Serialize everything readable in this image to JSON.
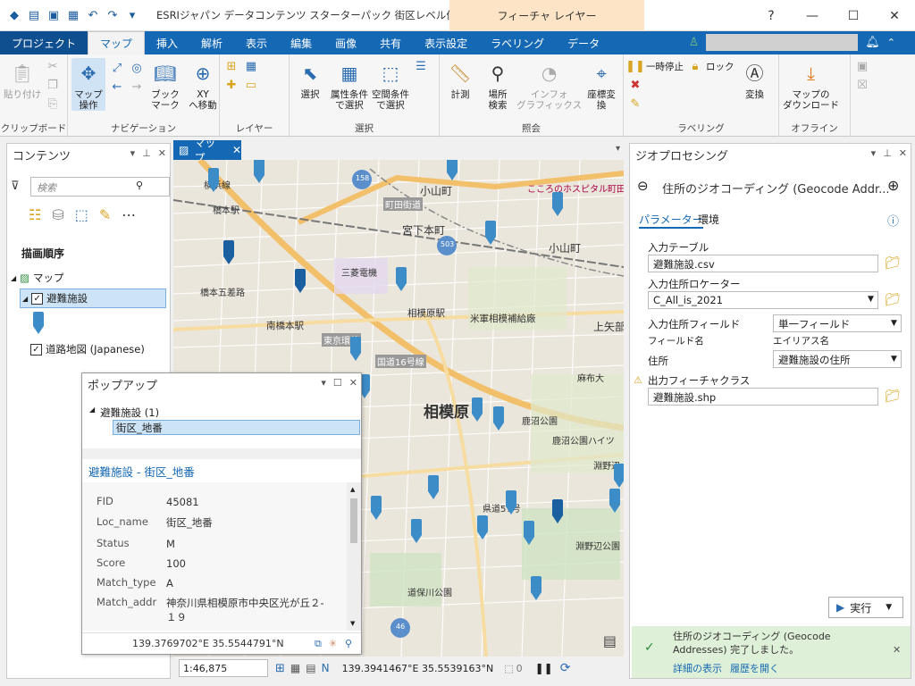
{
  "window": {
    "title": "ESRIジャパン データコンテンツ スターターパック 街区レベル住所 - マッ...",
    "context_tab": "フィーチャ レイヤー",
    "help": "?",
    "minimize": "—",
    "maximize": "☐",
    "close": "✕"
  },
  "tabs": [
    "マップ",
    "挿入",
    "解析",
    "表示",
    "編集",
    "画像",
    "共有",
    "表示設定",
    "ラベリング",
    "データ"
  ],
  "project_tab": "プロジェクト",
  "ribbon": {
    "clipboard": {
      "paste": "貼り付け",
      "label": "クリップボード"
    },
    "navigation": {
      "explore": "マップ\n操作",
      "bookmarks": "ブック\nマーク",
      "go_xy": "XY\nへ移動",
      "label": "ナビゲーション"
    },
    "layer": {
      "label": "レイヤー"
    },
    "selection": {
      "select": "選択",
      "by_attr": "属性条件\nで選択",
      "by_loc": "空間条件\nで選択",
      "label": "選択"
    },
    "inquiry": {
      "measure": "計測",
      "locate": "場所\n検索",
      "infographics": "インフォ\nグラフィックス",
      "convert_coords": "座標変換",
      "label": "照会"
    },
    "labeling": {
      "pause": "一時停止",
      "lock": "ロック",
      "convert": "変換",
      "label": "ラベリング"
    },
    "offline": {
      "download": "マップの\nダウンロード",
      "label": "オフライン"
    }
  },
  "contents": {
    "title": "コンテンツ",
    "search_placeholder": "検索",
    "draw_order": "描画順序",
    "map": "マップ",
    "layer1": "避難施設",
    "layer2": "道路地図 (Japanese)"
  },
  "map": {
    "tab": "マップ",
    "labels": [
      "小山町",
      "宮下本町",
      "小山町",
      "三菱電機",
      "橋本五差路",
      "相模原駅",
      "南橋本駅",
      "米軍相模補給廠",
      "上矢部",
      "東京環状",
      "国道16号線",
      "麻布大",
      "相模原",
      "鹿沼公園",
      "鹿沼公園ハイツ",
      "淵野辺",
      "淵野辺公園",
      "県道57号",
      "横浜線",
      "橋本駅",
      "町田街道",
      "こころのホスピタル町田",
      "道保川公園"
    ],
    "route_shields": [
      "158",
      "503",
      "46"
    ],
    "scale": "1:46,875",
    "coords": "139.3941467°E 35.5539163°N",
    "selected_count": "0"
  },
  "popup": {
    "title": "ポップアップ",
    "tree_layer": "避難施設 (1)",
    "tree_item": "街区_地番",
    "heading": "避難施設 - 街区_地番",
    "fields": [
      {
        "k": "FID",
        "v": "45081"
      },
      {
        "k": "Loc_name",
        "v": "街区_地番"
      },
      {
        "k": "Status",
        "v": "M"
      },
      {
        "k": "Score",
        "v": "100"
      },
      {
        "k": "Match_type",
        "v": "A"
      },
      {
        "k": "Match_addr",
        "v": "神奈川県相模原市中央区光が丘２-１９"
      }
    ],
    "coords": "139.3769702°E 35.5544791°N"
  },
  "geo": {
    "title": "ジオプロセシング",
    "tool": "住所のジオコーディング (Geocode Addr...",
    "tab_params": "パラメーター",
    "tab_env": "環境",
    "input_table_label": "入力テーブル",
    "input_table": "避難施設.csv",
    "locator_label": "入力住所ロケーター",
    "locator": "C_All_is_2021",
    "addr_fields_label": "入力住所フィールド",
    "addr_fields": "単一フィールド",
    "field_name_label": "フィールド名",
    "alias_label": "エイリアス名",
    "address_label": "住所",
    "address_field": "避難施設の住所",
    "output_label": "出力フィーチャクラス",
    "output": "避難施設.shp",
    "run": "実行",
    "msg": "住所のジオコーディング (Geocode Addresses) 完了しました。",
    "details": "詳細の表示",
    "history": "履歴を開く"
  },
  "colors": {
    "accent": "#1569b4",
    "pin": "#3c8cc8",
    "pin_selected": "#1a5fa0"
  }
}
